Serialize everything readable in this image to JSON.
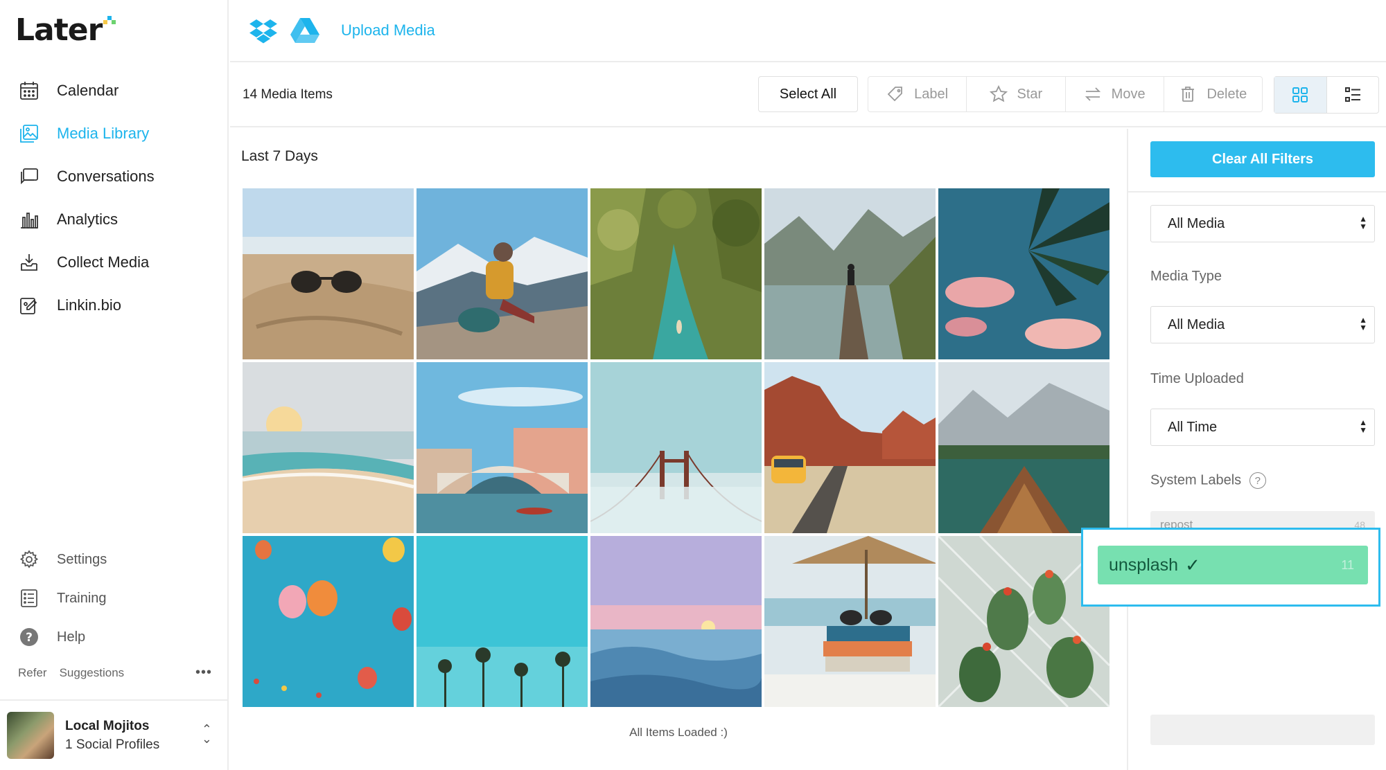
{
  "app": {
    "logo": "Later",
    "colors": {
      "accent": "#1db4ec",
      "primary_button": "#2dbcee",
      "label_chip": "#77e0b0"
    }
  },
  "sidebar": {
    "nav": [
      {
        "label": "Calendar",
        "icon": "calendar-icon"
      },
      {
        "label": "Media Library",
        "icon": "media-library-icon",
        "active": true
      },
      {
        "label": "Conversations",
        "icon": "conversations-icon"
      },
      {
        "label": "Analytics",
        "icon": "analytics-icon"
      },
      {
        "label": "Collect Media",
        "icon": "collect-media-icon"
      },
      {
        "label": "Linkin.bio",
        "icon": "linkinbio-icon"
      }
    ],
    "bottom_nav": [
      {
        "label": "Settings",
        "icon": "gear-icon"
      },
      {
        "label": "Training",
        "icon": "training-icon"
      },
      {
        "label": "Help",
        "icon": "help-icon"
      }
    ],
    "refer": "Refer",
    "suggestions": "Suggestions",
    "more": "•••",
    "profile": {
      "name": "Local Mojitos",
      "subtitle": "1 Social Profiles"
    }
  },
  "topbar": {
    "upload_label": "Upload Media",
    "icons": [
      "dropbox-icon",
      "google-drive-icon"
    ]
  },
  "toolbar": {
    "count": "14 Media Items",
    "select_all": "Select All",
    "label": "Label",
    "star": "Star",
    "move": "Move",
    "delete": "Delete",
    "views": [
      "grid-view-icon",
      "list-view-icon"
    ]
  },
  "content": {
    "section_title": "Last 7 Days",
    "footer": "All Items Loaded :)",
    "tiles": [
      {
        "name": "sunglasses-on-sand"
      },
      {
        "name": "hiker-mountains"
      },
      {
        "name": "jungle-river"
      },
      {
        "name": "lake-pier"
      },
      {
        "name": "palm-pink-clouds"
      },
      {
        "name": "beach-sunset"
      },
      {
        "name": "venice-rialto"
      },
      {
        "name": "bridge-fog"
      },
      {
        "name": "desert-van"
      },
      {
        "name": "lake-boat"
      },
      {
        "name": "hot-air-balloons"
      },
      {
        "name": "palm-trees-sky"
      },
      {
        "name": "ocean-sunset"
      },
      {
        "name": "books-sunglasses"
      },
      {
        "name": "cactus-greenhouse"
      }
    ]
  },
  "filters": {
    "clear_all": "Clear All Filters",
    "source_select": "All Media",
    "media_type_label": "Media Type",
    "media_type_value": "All Media",
    "time_label": "Time Uploaded",
    "time_value": "All Time",
    "system_labels": "System Labels",
    "help": "?",
    "labels": [
      {
        "name": "repost",
        "count": "48"
      },
      {
        "name": "unsplash",
        "count": "11",
        "selected": true
      }
    ]
  }
}
